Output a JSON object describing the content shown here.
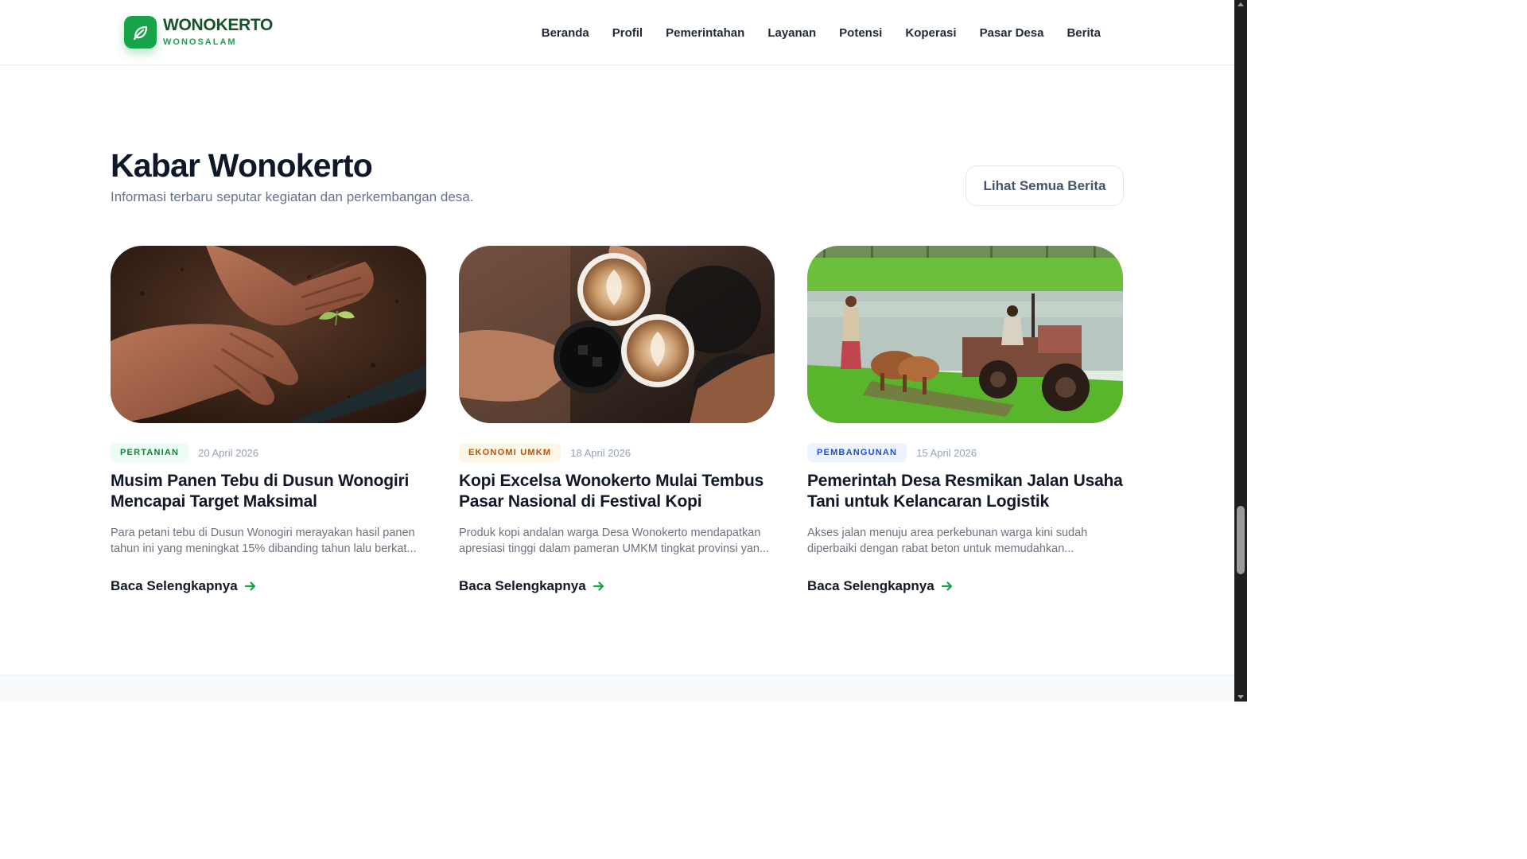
{
  "brand": {
    "name": "WONOKERTO",
    "subtitle": "WONOSALAM",
    "logo_icon": "leaf-icon"
  },
  "nav": {
    "items": [
      {
        "label": "Beranda"
      },
      {
        "label": "Profil"
      },
      {
        "label": "Pemerintahan"
      },
      {
        "label": "Layanan"
      },
      {
        "label": "Potensi"
      },
      {
        "label": "Koperasi"
      },
      {
        "label": "Pasar Desa"
      },
      {
        "label": "Berita"
      }
    ]
  },
  "news": {
    "title": "Kabar Wonokerto",
    "subtitle": "Informasi terbaru seputar kegiatan dan perkembangan desa.",
    "see_all_label": "Lihat Semua Berita",
    "read_more_label": "Baca Selengkapnya",
    "cards": [
      {
        "category": "PERTANIAN",
        "category_color": "#15803d",
        "category_bg": "#ecfdf3",
        "date": "20 April 2026",
        "title": "Musim Panen Tebu di Dusun Wonogiri Mencapai Target Maksimal",
        "excerpt": "Para petani tebu di Dusun Wonogiri merayakan hasil panen tahun ini yang meningkat 15% dibanding tahun lalu berkat...",
        "image": "hands-planting-seedling-photo"
      },
      {
        "category": "EKONOMI UMKM",
        "category_color": "#b45309",
        "category_bg": "#fef6e7",
        "date": "18 April 2026",
        "title": "Kopi Excelsa Wonokerto Mulai Tembus Pasar Nasional di Festival Kopi",
        "excerpt": "Produk kopi andalan warga Desa Wonokerto mendapatkan apresiasi tinggi dalam pameran UMKM tingkat provinsi yan...",
        "image": "coffee-cups-toast-photo"
      },
      {
        "category": "PEMBANGUNAN",
        "category_color": "#1d4ed8",
        "category_bg": "#eef4ff",
        "date": "15 April 2026",
        "title": "Pemerintah Desa Resmikan Jalan Usaha Tani untuk Kelancaran Logistik",
        "excerpt": "Akses jalan menuju area perkebunan warga kini sudah diperbaiki dengan rabat beton untuk memudahkan...",
        "image": "farmers-tractor-rice-field-photo"
      }
    ]
  },
  "colors": {
    "accent": "#16a34a",
    "accent_dark": "#14532d",
    "text": "#0f172a"
  }
}
